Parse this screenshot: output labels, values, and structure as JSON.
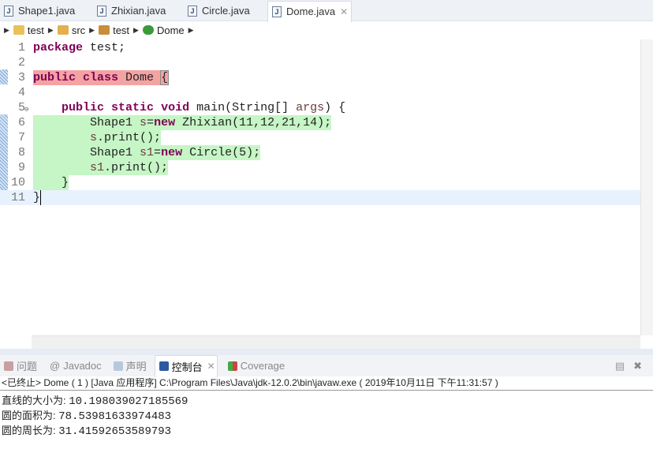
{
  "tabs": [
    {
      "label": "Shape1.java"
    },
    {
      "label": "Zhixian.java"
    },
    {
      "label": "Circle.java"
    },
    {
      "label": "Dome.java",
      "active": true
    }
  ],
  "breadcrumb": [
    "test",
    "src",
    "test",
    "Dome"
  ],
  "editor": {
    "lines": [
      {
        "n": "1",
        "code": "package test;"
      },
      {
        "n": "2",
        "code": ""
      },
      {
        "n": "3",
        "code": "public class Dome {"
      },
      {
        "n": "4",
        "code": ""
      },
      {
        "n": "5",
        "code": "    public static void main(String[] args) {"
      },
      {
        "n": "6",
        "code": "        Shape1 s=new Zhixian(11,12,21,14);"
      },
      {
        "n": "7",
        "code": "        s.print();"
      },
      {
        "n": "8",
        "code": "        Shape1 s1=new Circle(5);"
      },
      {
        "n": "9",
        "code": "        s1.print();"
      },
      {
        "n": "10",
        "code": "    }"
      },
      {
        "n": "11",
        "code": "}"
      }
    ]
  },
  "panel": {
    "tabs": [
      "问题",
      "Javadoc",
      "声明",
      "控制台",
      "Coverage"
    ],
    "active": "控制台"
  },
  "console": {
    "header": "<已终止> Dome ( 1 )  [Java 应用程序] C:\\Program Files\\Java\\jdk-12.0.2\\bin\\javaw.exe ( 2019年10月11日 下午11:31:57 )",
    "output": [
      {
        "label": "直线的大小为: ",
        "value": "10.198039027185569"
      },
      {
        "label": "圆的面积为: ",
        "value": "78.53981633974483"
      },
      {
        "label": "圆的周长为: ",
        "value": "31.41592653589793"
      }
    ]
  },
  "colors": {
    "error_highlight": "#f4a3a3",
    "coverage_highlight": "#c6f5c6",
    "current_line": "#e8f2fe",
    "keyword": "#7f0055"
  }
}
